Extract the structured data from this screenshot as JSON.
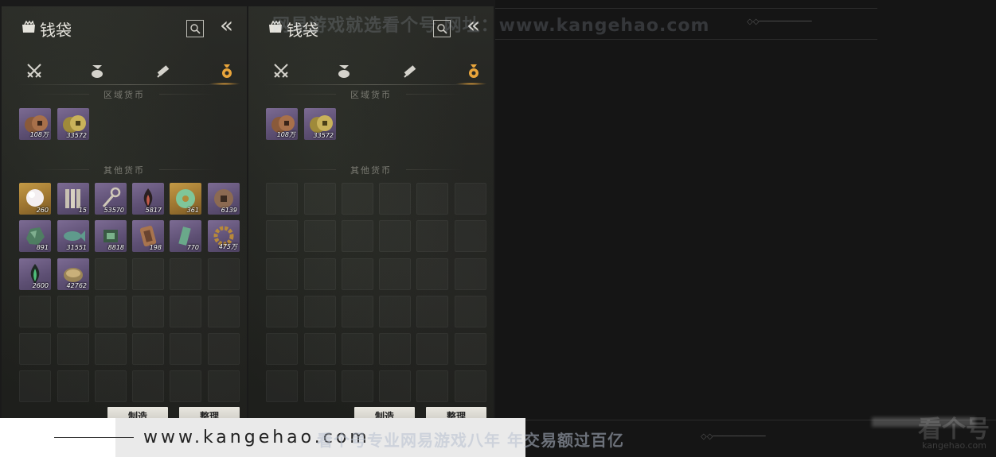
{
  "panels": [
    {
      "title": "钱袋",
      "regional_section": "区域货币",
      "other_section": "其他货币",
      "regional_items": [
        {
          "icon": "copper-coins-icon",
          "qty": "108万",
          "rarity": "purple"
        },
        {
          "icon": "gold-coins-icon",
          "qty": "33572",
          "rarity": "purple"
        }
      ],
      "other_items": [
        {
          "icon": "pearl-icon",
          "qty": "260",
          "rarity": "gold"
        },
        {
          "icon": "bamboo-slips-icon",
          "qty": "15",
          "rarity": "purple"
        },
        {
          "icon": "ornament-key-icon",
          "qty": "53570",
          "rarity": "purple"
        },
        {
          "icon": "dark-flame-icon",
          "qty": "5817",
          "rarity": "purple"
        },
        {
          "icon": "jade-disc-icon",
          "qty": "361",
          "rarity": "gold"
        },
        {
          "icon": "ancient-coin-icon",
          "qty": "6139",
          "rarity": "purple"
        },
        {
          "icon": "green-ore-icon",
          "qty": "891",
          "rarity": "purple"
        },
        {
          "icon": "jade-fish-icon",
          "qty": "31551",
          "rarity": "purple"
        },
        {
          "icon": "jade-fragment-icon",
          "qty": "8818",
          "rarity": "purple"
        },
        {
          "icon": "bronze-plate-icon",
          "qty": "198",
          "rarity": "purple"
        },
        {
          "icon": "jade-token-icon",
          "qty": "770",
          "rarity": "purple"
        },
        {
          "icon": "bead-bracelet-icon",
          "qty": "475万",
          "rarity": "purple"
        },
        {
          "icon": "green-spirit-icon",
          "qty": "2600",
          "rarity": "purple"
        },
        {
          "icon": "shell-coin-icon",
          "qty": "42762",
          "rarity": "purple"
        }
      ],
      "buttons": [
        "制造",
        "整理"
      ]
    },
    {
      "title": "钱袋",
      "regional_section": "区域货币",
      "other_section": "其他货币",
      "regional_items": [
        {
          "icon": "copper-coins-icon",
          "qty": "108万",
          "rarity": "purple"
        },
        {
          "icon": "gold-coins-icon",
          "qty": "33572",
          "rarity": "purple"
        }
      ],
      "other_items": [],
      "buttons": [
        "制造",
        "整理"
      ]
    }
  ],
  "tabs": [
    "weapons-tab",
    "pouch-tab",
    "scroll-tab",
    "currency-tab"
  ],
  "active_tab": 3,
  "watermark_top": "网易游戏就选看个号  网址：www.kangehao.com",
  "watermark_bottom": "看个号专业网易游戏八年  年交易额过百亿",
  "logo_watermark": "看个号",
  "logo_watermark_url": "kangehao.com",
  "url_banner": "www.kangehao.com",
  "colors": {
    "accent_gold": "#e9a53b",
    "rarity_purple": "#6d5d85",
    "rarity_gold": "#b0883a"
  }
}
